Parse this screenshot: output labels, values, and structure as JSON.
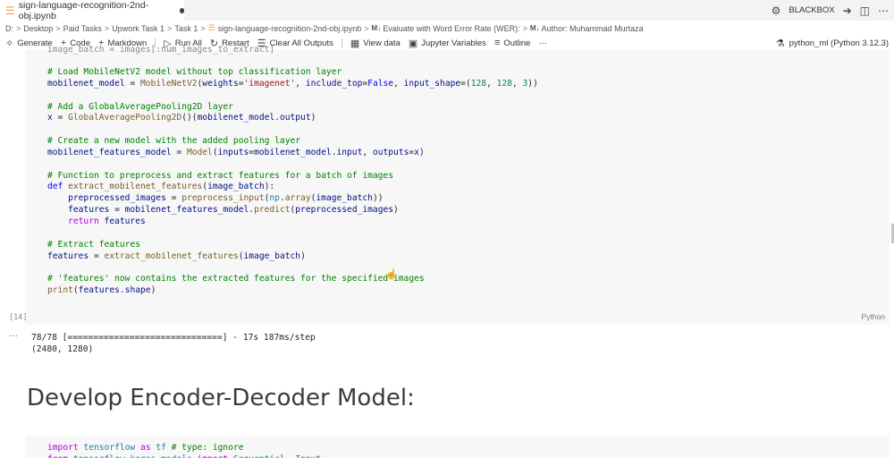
{
  "tab": {
    "label": "sign-language-recognition-2nd-obj.ipynb"
  },
  "top_right": {
    "account_label": "BLACKBOX"
  },
  "breadcrumb": [
    "D:",
    "Desktop",
    "Paid Tasks",
    "Upwork Task 1",
    "Task 1",
    "sign-language-recognition-2nd-obj.ipynb",
    "Evaluate with Word Error Rate (WER):",
    "Author: Muhammad Murtaza"
  ],
  "toolbar": {
    "generate": "Generate",
    "code": "Code",
    "markdown": "Markdown",
    "run_all": "Run All",
    "restart": "Restart",
    "clear_outputs": "Clear All Outputs",
    "view_data": "View data",
    "jupyter_variables": "Jupyter Variables",
    "outline": "Outline",
    "more": "···",
    "kernel": "python_ml (Python 3.12.3)"
  },
  "cell": {
    "top_fragment": "image_batch = images[:num_images_to_extract]",
    "exec_count": "[14]",
    "language": "Python"
  },
  "output": {
    "ellipsis": "···",
    "lines": [
      "78/78 [==============================] - 17s 187ms/step",
      "(2480, 1280)"
    ]
  },
  "markdown": {
    "heading": "Develop Encoder-Decoder Model:"
  },
  "cell2": {
    "first_line_comment": "# type: ignore"
  },
  "colors": {
    "notebook_icon": "#e8a33d",
    "comment": "#008000",
    "keyword": "#0000ff",
    "function": "#795e26",
    "string": "#a31515",
    "number": "#098658"
  }
}
